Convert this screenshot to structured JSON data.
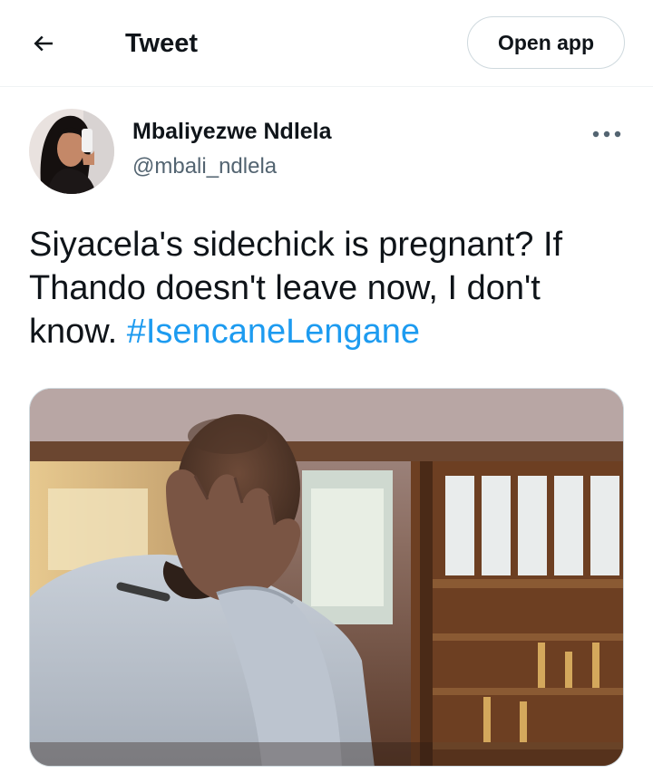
{
  "header": {
    "title": "Tweet",
    "open_app_label": "Open app",
    "back_icon": "arrow-left-icon"
  },
  "tweet": {
    "author_name": "Mbaliyezwe Ndlela",
    "author_handle": "@mbali_ndlela",
    "text_line_1": "Siyacela's sidechick is pregnant? If Thando doesn't leave now, I don't know. ",
    "hashtag": "#IsencaneLengane",
    "more_icon": "more-dots-icon",
    "media": "photo of a man in a grey hooded top covering his face with his hand, wooden shelves in background"
  },
  "colors": {
    "accent": "#1d9bf0",
    "text_primary": "#0f1419",
    "text_secondary": "#536471",
    "border": "#cfd9de"
  }
}
